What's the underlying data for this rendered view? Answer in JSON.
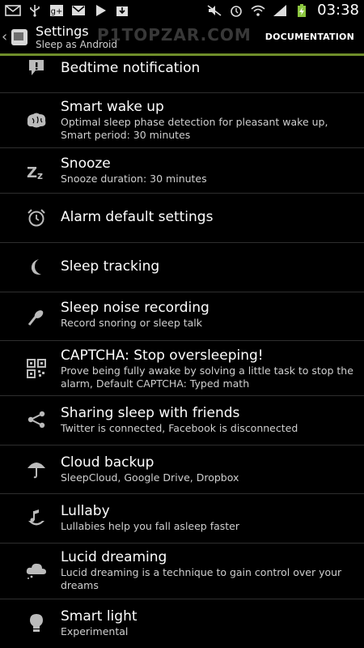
{
  "status_bar": {
    "time": "03:38"
  },
  "action_bar": {
    "title": "Settings",
    "subtitle": "Sleep as Android",
    "documentation_label": "DOCUMENTATION",
    "watermark": "P1TOPZAR.COM"
  },
  "items": [
    {
      "title": "Bedtime notification",
      "summary": ""
    },
    {
      "title": "Smart wake up",
      "summary": "Optimal sleep phase detection for pleasant wake up, Smart period: 30 minutes"
    },
    {
      "title": "Snooze",
      "summary": "Snooze duration: 30 minutes"
    },
    {
      "title": "Alarm default settings",
      "summary": ""
    },
    {
      "title": "Sleep tracking",
      "summary": ""
    },
    {
      "title": "Sleep noise recording",
      "summary": "Record snoring or sleep talk"
    },
    {
      "title": "CAPTCHA: Stop oversleeping!",
      "summary": "Prove being fully awake by solving a little task to stop the alarm, Default CAPTCHA: Typed math"
    },
    {
      "title": "Sharing sleep with friends",
      "summary": "Twitter is connected, Facebook is disconnected"
    },
    {
      "title": "Cloud backup",
      "summary": "SleepCloud, Google Drive, Dropbox"
    },
    {
      "title": "Lullaby",
      "summary": "Lullabies help you fall asleep faster"
    },
    {
      "title": "Lucid dreaming",
      "summary": "Lucid dreaming is a technique to gain control over your dreams"
    },
    {
      "title": "Smart light",
      "summary": "Experimental"
    }
  ]
}
